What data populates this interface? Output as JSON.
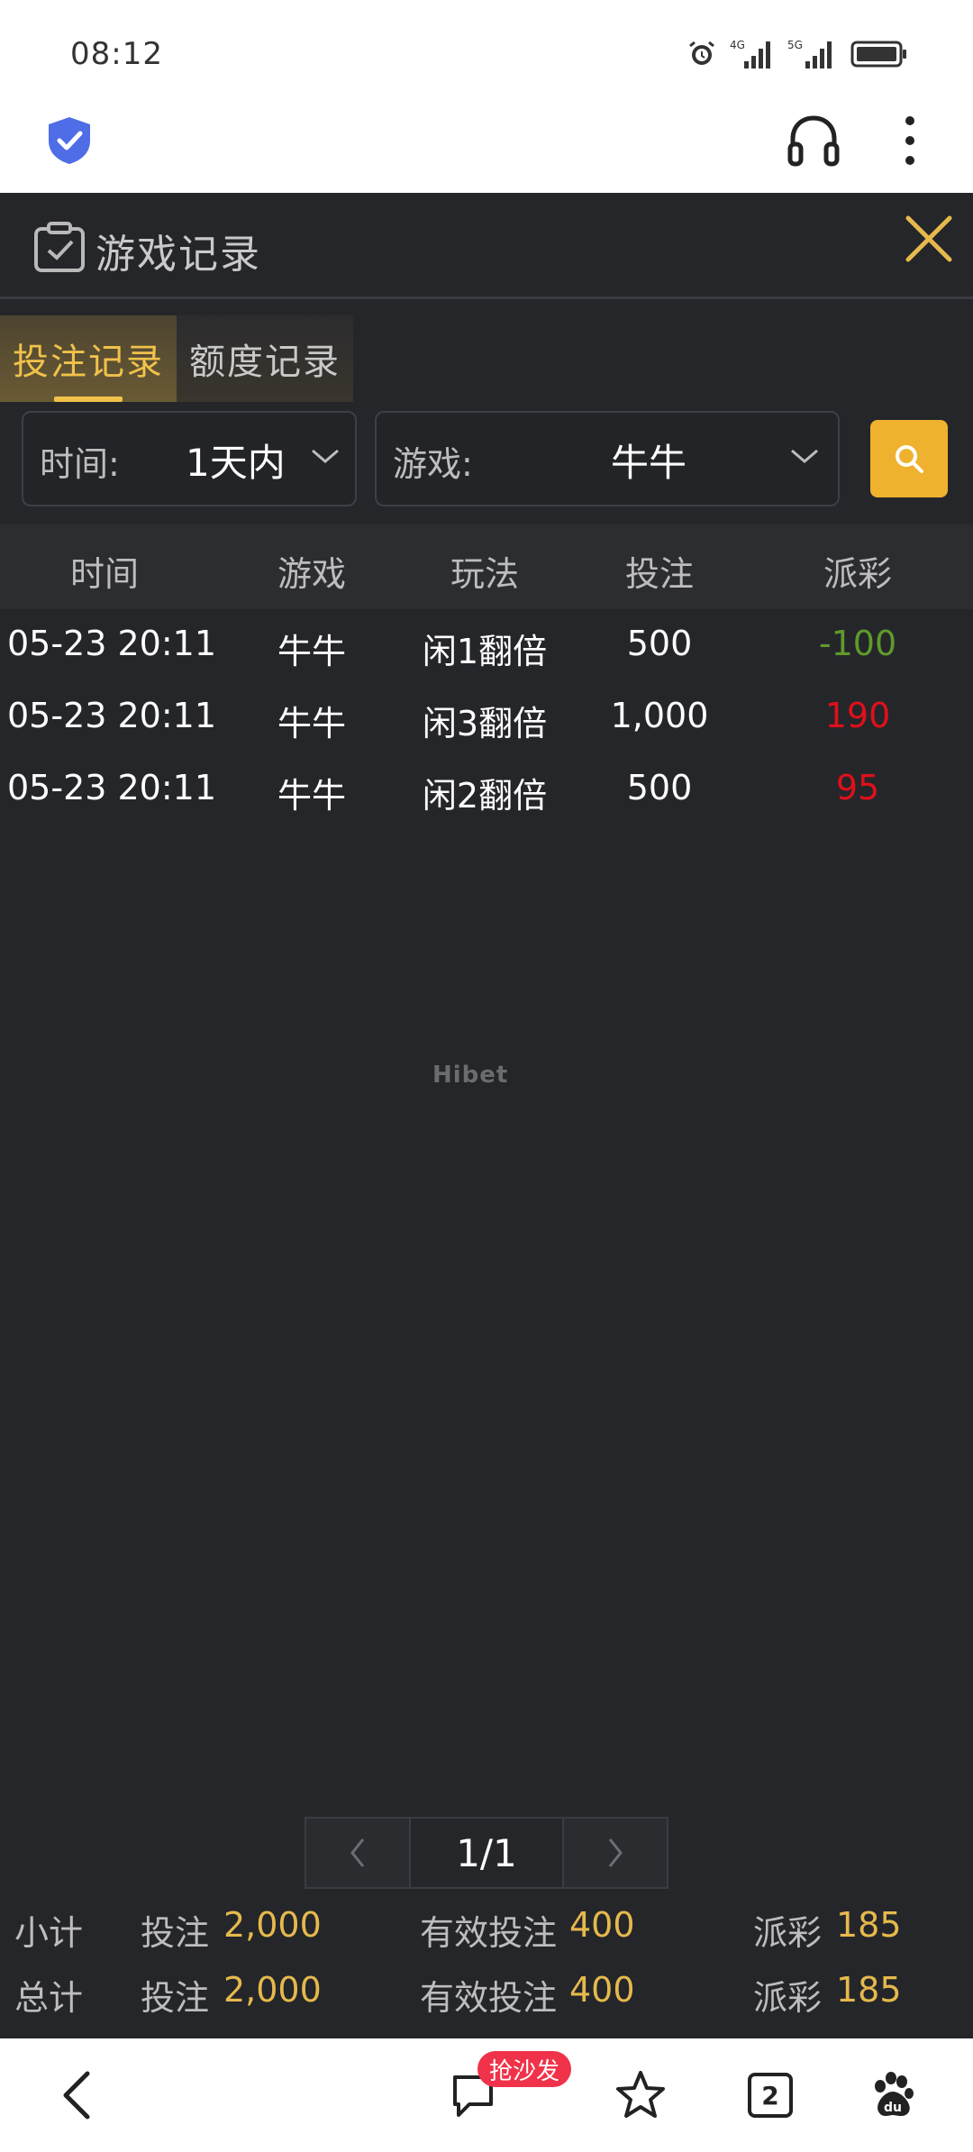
{
  "status": {
    "time": "08:12",
    "net1": "4G",
    "net2": "5G"
  },
  "panel": {
    "title": "游戏记录",
    "tabs": [
      {
        "label": "投注记录",
        "active": true
      },
      {
        "label": "额度记录",
        "active": false
      }
    ],
    "filters": {
      "time_label": "时间:",
      "time_value": "1天内",
      "game_label": "游戏:",
      "game_value": "牛牛"
    },
    "columns": [
      "时间",
      "游戏",
      "玩法",
      "投注",
      "派彩"
    ],
    "rows": [
      {
        "time": "05-23 20:11",
        "game": "牛牛",
        "play": "闲1翻倍",
        "bet": "500",
        "payout": "-100",
        "payout_color": "#5f9a2a"
      },
      {
        "time": "05-23 20:11",
        "game": "牛牛",
        "play": "闲3翻倍",
        "bet": "1,000",
        "payout": "190",
        "payout_color": "#e0101a"
      },
      {
        "time": "05-23 20:11",
        "game": "牛牛",
        "play": "闲2翻倍",
        "bet": "500",
        "payout": "95",
        "payout_color": "#e0101a"
      }
    ],
    "watermark": "Hibet",
    "pager": {
      "current": "1/1"
    },
    "subtotal": {
      "label": "小计",
      "bet_label": "投注",
      "bet": "2,000",
      "valid_label": "有效投注",
      "valid": "400",
      "payout_label": "派彩",
      "payout": "185"
    },
    "total": {
      "label": "总计",
      "bet_label": "投注",
      "bet": "2,000",
      "valid_label": "有效投注",
      "valid": "400",
      "payout_label": "派彩",
      "payout": "185"
    }
  },
  "nav": {
    "sofa_badge": "抢沙发",
    "tab_count": "2"
  },
  "colors": {
    "accent": "#efb22f",
    "gold_text": "#e5b94c",
    "bg": "#25262a"
  }
}
